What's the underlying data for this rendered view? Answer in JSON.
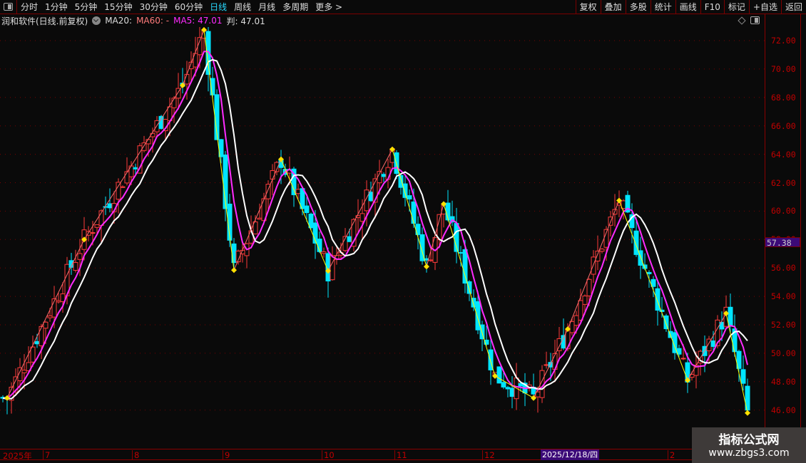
{
  "toolbar": {
    "periods": [
      "分时",
      "1分钟",
      "5分钟",
      "15分钟",
      "30分钟",
      "60分钟",
      "日线",
      "周线",
      "月线",
      "多周期",
      "更多 >"
    ],
    "active": "日线",
    "right_buttons": [
      "复权",
      "叠加",
      "多股",
      "统计",
      "画线",
      "F10",
      "标记",
      "+自选",
      "返回"
    ]
  },
  "info": {
    "title": "润和软件(日线.前复权)",
    "ma20": "MA20:",
    "ma60": "MA60: -",
    "ma5": "MA5: 47.01",
    "pan": "判: 47.01"
  },
  "colors": {
    "up": "#ff3b3b",
    "down": "#00e5ff",
    "ma5": "#ff2bff",
    "white_line": "#ffffff",
    "zig_up": "#ff6b6b",
    "zig_down": "#ffff00",
    "pivot": "#ffe000",
    "axis": "#c00000"
  },
  "axis": {
    "price_labels": [
      "72.00",
      "70.00",
      "68.00",
      "66.00",
      "64.00",
      "62.00",
      "60.00",
      "58.00",
      "56.00",
      "54.00",
      "52.00",
      "50.00",
      "48.00",
      "46.00"
    ],
    "current_price": "57.38"
  },
  "xaxis": {
    "months": [
      "2025年",
      "7",
      "8",
      "9",
      "10",
      "11",
      "12",
      "2"
    ],
    "cursor_date": "2025/12/18/四"
  },
  "watermark": {
    "line1": "指标公式网",
    "line2": "www.zbgs3.com"
  },
  "chart_data": {
    "type": "candlestick",
    "ylim": [
      45,
      73
    ],
    "pivots": [
      [
        1,
        46.85
      ],
      [
        19,
        58.0
      ],
      [
        42,
        68.85
      ],
      [
        47,
        72.75
      ],
      [
        54,
        55.85
      ],
      [
        65,
        63.65
      ],
      [
        76,
        55.8
      ],
      [
        91,
        64.35
      ],
      [
        99,
        56.1
      ],
      [
        103,
        60.5
      ],
      [
        115,
        48.4
      ],
      [
        124,
        46.85
      ],
      [
        132,
        51.7
      ],
      [
        144,
        60.75
      ],
      [
        160,
        48.1
      ],
      [
        169,
        52.8
      ],
      [
        174,
        45.8
      ]
    ],
    "last_close": 47.01
  }
}
